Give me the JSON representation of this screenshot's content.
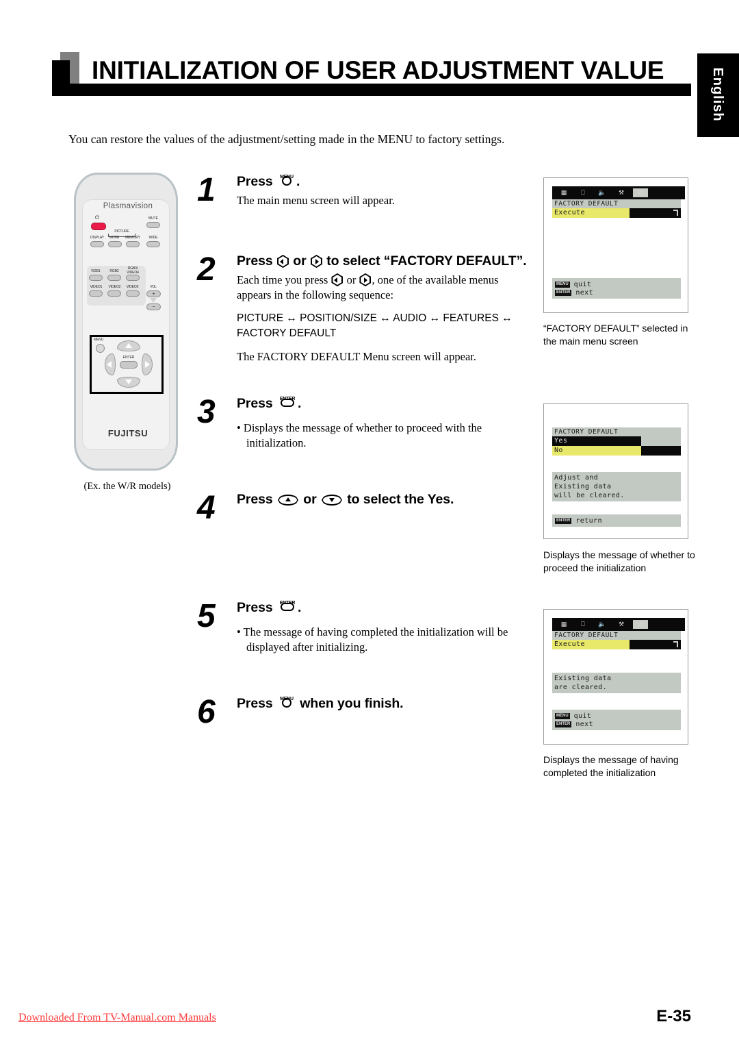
{
  "header": {
    "title": "INITIALIZATION OF USER ADJUSTMENT VALUE",
    "language_tab": "English"
  },
  "intro": "You can restore the values of the adjustment/setting made in the MENU to factory settings.",
  "remote": {
    "brand": "Plasmavision",
    "maker": "FUJITSU",
    "caption": "(Ex. the W/R models)",
    "buttons": {
      "power_symbol": "⏻",
      "mute": "MUTE",
      "picture_group": "PICTURE",
      "display": "DISPLAY",
      "mode": "MODE",
      "memory": "MEMORY",
      "wide": "WIDE",
      "rgb1": "RGB1",
      "rgb2": "RGB2",
      "rgb3_video4": "RGB3/\nVIDEO4",
      "video1": "VIDEO1",
      "video2": "VIDEO2",
      "video3": "VIDEO3",
      "vol": "VOL",
      "vol_plus": "+",
      "vol_minus": "−",
      "menu": "MENU",
      "enter": "ENTER"
    }
  },
  "steps": [
    {
      "num": "1",
      "head_pre": "Press",
      "key": "menu-key",
      "key_label": "MENU",
      "head_post": ".",
      "sub": "The main menu screen will appear."
    },
    {
      "num": "2",
      "head_pre": "Press",
      "head_mid": "or",
      "head_post": "to select “FACTORY DEFAULT”.",
      "key_left_label": "left-arrow",
      "key_right_label": "right-arrow",
      "sub_pre": "Each time you press",
      "sub_mid": "or",
      "sub_post": ", one of the available menus appears in the following sequence:",
      "sequence": "PICTURE ↔ POSITION/SIZE ↔ AUDIO ↔ FEATURES ↔ FACTORY DEFAULT",
      "tail": "The FACTORY DEFAULT Menu screen will appear."
    },
    {
      "num": "3",
      "head_pre": "Press",
      "key_label": "ENTER",
      "head_post": ".",
      "bullet": "• Displays the message of whether to proceed with the initialization."
    },
    {
      "num": "4",
      "head_pre": "Press",
      "head_mid": "or",
      "head_post": "to select the Yes.",
      "key_up_label": "up-arrow",
      "key_down_label": "down-arrow"
    },
    {
      "num": "5",
      "head_pre": "Press",
      "key_label": "ENTER",
      "head_post": ".",
      "bullet": "• The message of having completed the initialization will be displayed after initializing."
    },
    {
      "num": "6",
      "head_pre": "Press",
      "key_label": "MENU",
      "head_post": "when you finish."
    }
  ],
  "osd_panels": [
    {
      "id": "panel-main-menu",
      "menu_icons": [
        "picture-icon",
        "position-size-icon",
        "audio-icon",
        "features-icon",
        "factory-default-icon"
      ],
      "active_icon_index": 4,
      "title": "FACTORY DEFAULT",
      "rows": [
        {
          "label": "Execute",
          "highlighted": true,
          "chevron": true
        }
      ],
      "message": "",
      "legend": [
        {
          "key": "MENU",
          "text": "quit"
        },
        {
          "key": "ENTER",
          "text": "next"
        }
      ],
      "caption": "“FACTORY DEFAULT” selected in the main menu screen"
    },
    {
      "id": "panel-confirm",
      "menu_icons": [],
      "title": "FACTORY DEFAULT",
      "rows": [
        {
          "label": "Yes",
          "selected": true
        },
        {
          "label": "No",
          "selected": false
        }
      ],
      "message": "Adjust and\nExisting data\nwill be cleared.",
      "legend": [
        {
          "key": "ENTER",
          "text": "return"
        }
      ],
      "caption": "Displays the message of whether to proceed the initialization"
    },
    {
      "id": "panel-complete",
      "menu_icons": [
        "picture-icon",
        "position-size-icon",
        "audio-icon",
        "features-icon",
        "factory-default-icon"
      ],
      "active_icon_index": 4,
      "title": "FACTORY DEFAULT",
      "rows": [
        {
          "label": "Execute",
          "highlighted": true,
          "chevron": true
        }
      ],
      "message": "Existing data\nare cleared.",
      "legend": [
        {
          "key": "MENU",
          "text": "quit"
        },
        {
          "key": "ENTER",
          "text": "next"
        }
      ],
      "caption": "Displays the message of having completed the initialization"
    }
  ],
  "footer": {
    "link": "Downloaded From TV-Manual.com Manuals",
    "page": "E-35"
  },
  "colors": {
    "accent_red": "#ff3b3b",
    "power_button": "#ec1c4a",
    "osd_panel_bg": "#c2c8c2",
    "osd_bar_black": "#0a0a0a",
    "osd_highlight_yellow": "#e8e86a"
  }
}
